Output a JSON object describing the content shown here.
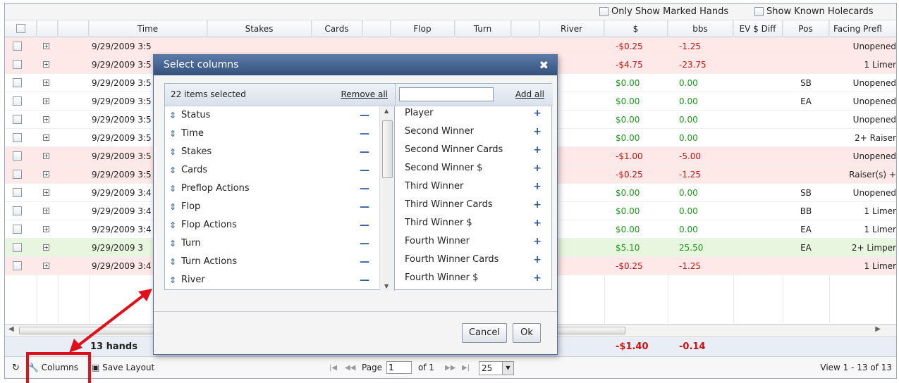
{
  "topbar": {
    "only_marked": "Only Show Marked Hands",
    "show_known": "Show Known Holecards"
  },
  "columns": [
    "Time",
    "Stakes",
    "Cards",
    "Flop",
    "Turn",
    "River",
    "$",
    "bbs",
    "EV $ Diff",
    "Pos",
    "Facing Prefl"
  ],
  "rows": [
    {
      "time": "9/29/2009 3:5",
      "usd": "-$0.25",
      "bbs": "-1.25",
      "pos": "",
      "facing": "Unopened",
      "color": "red",
      "sign": "neg"
    },
    {
      "time": "9/29/2009 3:5",
      "usd": "-$4.75",
      "bbs": "-23.75",
      "pos": "",
      "facing": "1 Limer",
      "color": "red",
      "sign": "neg"
    },
    {
      "time": "9/29/2009 3:5",
      "usd": "$0.00",
      "bbs": "0.00",
      "pos": "SB",
      "facing": "Unopened",
      "color": "wht",
      "sign": "pos"
    },
    {
      "time": "9/29/2009 3:5",
      "usd": "$0.00",
      "bbs": "0.00",
      "pos": "EA",
      "facing": "Unopened",
      "color": "wht",
      "sign": "pos"
    },
    {
      "time": "9/29/2009 3:5",
      "usd": "$0.00",
      "bbs": "0.00",
      "pos": "",
      "facing": "Unopened",
      "color": "wht",
      "sign": "pos"
    },
    {
      "time": "9/29/2009 3:5",
      "usd": "$0.00",
      "bbs": "0.00",
      "pos": "",
      "facing": "2+ Raiser",
      "color": "wht",
      "sign": "pos"
    },
    {
      "time": "9/29/2009 3:5",
      "usd": "-$1.00",
      "bbs": "-5.00",
      "pos": "",
      "facing": "Unopened",
      "color": "red",
      "sign": "neg"
    },
    {
      "time": "9/29/2009 3:5",
      "usd": "-$0.25",
      "bbs": "-1.25",
      "pos": "",
      "facing": "Raiser(s) +",
      "color": "red",
      "sign": "neg"
    },
    {
      "time": "9/29/2009 3:4",
      "usd": "$0.00",
      "bbs": "0.00",
      "pos": "SB",
      "facing": "Unopened",
      "color": "wht",
      "sign": "pos"
    },
    {
      "time": "9/29/2009 3:4",
      "usd": "$0.00",
      "bbs": "0.00",
      "pos": "BB",
      "facing": "1 Limer",
      "color": "wht",
      "sign": "pos"
    },
    {
      "time": "9/29/2009 3:4",
      "usd": "$0.00",
      "bbs": "0.00",
      "pos": "EA",
      "facing": "1 Limer",
      "color": "wht",
      "sign": "pos"
    },
    {
      "time": "9/29/2009 3",
      "usd": "$5.10",
      "bbs": "25.50",
      "pos": "EA",
      "facing": "2+ Limper",
      "color": "grn",
      "sign": "pos"
    },
    {
      "time": "9/29/2009 3:4",
      "usd": "-$0.25",
      "bbs": "-1.25",
      "pos": "",
      "facing": "1 Limer",
      "color": "red",
      "sign": "neg"
    }
  ],
  "summary": {
    "hands": "13 hands",
    "usd": "-$1.40",
    "bbs": "-0.14"
  },
  "footer": {
    "columns": "Columns",
    "save_layout": "Save Layout",
    "page_label": "Page",
    "page_value": "1",
    "of_label": "of 1",
    "per_page": "25",
    "view": "View 1 - 13 of 13"
  },
  "modal": {
    "title": "Select columns",
    "selected_count": "22 items selected",
    "remove_all": "Remove all",
    "add_all": "Add all",
    "search_placeholder": "",
    "selected": [
      "Status",
      "Time",
      "Stakes",
      "Cards",
      "Preflop Actions",
      "Flop",
      "Flop Actions",
      "Turn",
      "Turn Actions",
      "River"
    ],
    "available": [
      "Player",
      "Second Winner",
      "Second Winner Cards",
      "Second Winner $",
      "Third Winner",
      "Third Winner Cards",
      "Third Winner $",
      "Fourth Winner",
      "Fourth Winner Cards",
      "Fourth Winner $"
    ],
    "cancel": "Cancel",
    "ok": "Ok"
  },
  "colors": {
    "negative": "#d01010",
    "positive": "#1a9a1a",
    "annotation": "#e0101a",
    "modal_header": "#3f5e8c"
  }
}
